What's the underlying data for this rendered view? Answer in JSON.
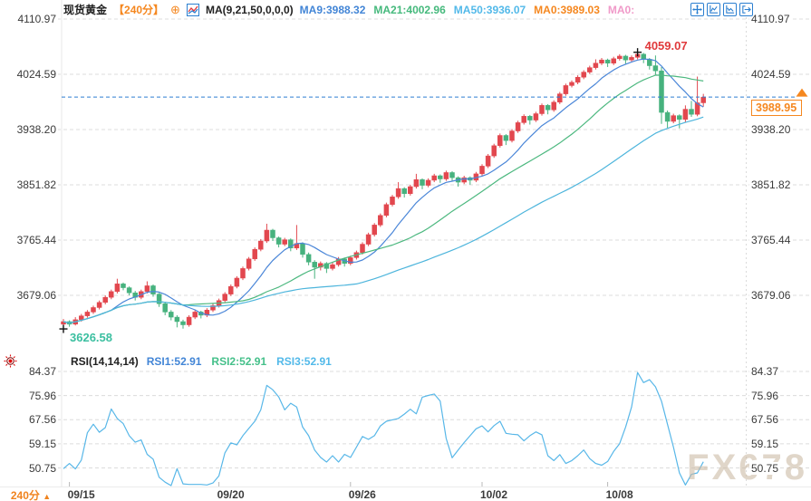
{
  "header": {
    "symbol": "现货黄金",
    "interval": "【240分】",
    "expand_icon": "⊕",
    "ma_settings": "MA(9,21,50,0,0,0)",
    "ma_values": [
      {
        "label": "MA9:3988.32",
        "color": "#4285d6"
      },
      {
        "label": "MA21:4002.96",
        "color": "#45b97c"
      },
      {
        "label": "MA50:3936.07",
        "color": "#52b9e9"
      },
      {
        "label": "MA0:3989.03",
        "color": "#f5871f"
      },
      {
        "label": "MA0:",
        "color": "#f09ac9"
      }
    ]
  },
  "toolbar_icons": [
    "move-icon",
    "chart-zoom-in-icon",
    "chart-zoom-out-icon",
    "exit-fullscreen-icon"
  ],
  "price_marker": {
    "last_price": "3988.95",
    "high_label": "4059.07",
    "low_label": "3626.58"
  },
  "rsi_header": {
    "title": "RSI(14,14,14)",
    "values": [
      {
        "label": "RSI1:52.91",
        "color": "#4285d6"
      },
      {
        "label": "RSI2:52.91",
        "color": "#45c08a"
      },
      {
        "label": "RSI3:52.91",
        "color": "#52b9e9"
      }
    ]
  },
  "bottom_tab": "240分",
  "watermark": "FX678",
  "colors": {
    "up": "#e2474e",
    "down": "#47b27e",
    "ma9": "#4a86d8",
    "ma21": "#4cb87f",
    "ma50": "#4db5dc",
    "rsi_line": "#58b7e8",
    "price_line": "#2d7dd2",
    "accent": "#f5871f",
    "grid": "#dcdcdc"
  },
  "chart_data": {
    "type": "candlestick",
    "title": "现货黄金 240分 (spot gold 4-hour)",
    "y_axis": [
      4110.97,
      4024.59,
      3938.2,
      3851.82,
      3765.44,
      3679.06
    ],
    "rsi_axis": [
      84.37,
      75.96,
      67.56,
      59.15,
      50.75
    ],
    "date_ticks": [
      {
        "label": "09/15",
        "i": 1
      },
      {
        "label": "09/20",
        "i": 26
      },
      {
        "label": "09/26",
        "i": 48
      },
      {
        "label": "10/02",
        "i": 70
      },
      {
        "label": "10/08",
        "i": 91
      }
    ],
    "high_marker": {
      "index": 96,
      "value": 4059.07
    },
    "low_marker": {
      "index": 0,
      "value": 3626.58
    },
    "last_price": 3988.95,
    "ma_lines": [
      {
        "period": 9,
        "color": "#4a86d8"
      },
      {
        "period": 21,
        "color": "#4cb87f"
      },
      {
        "period": 50,
        "color": "#4db5dc"
      }
    ],
    "candles": [
      [
        3634,
        3642,
        3626.58,
        3638
      ],
      [
        3638,
        3640,
        3630,
        3634
      ],
      [
        3634,
        3645,
        3632,
        3641
      ],
      [
        3641,
        3650,
        3638,
        3647
      ],
      [
        3647,
        3656,
        3644,
        3653
      ],
      [
        3653,
        3663,
        3650,
        3660
      ],
      [
        3660,
        3671,
        3657,
        3668
      ],
      [
        3668,
        3679,
        3665,
        3676
      ],
      [
        3676,
        3688,
        3673,
        3685
      ],
      [
        3685,
        3705,
        3682,
        3697
      ],
      [
        3697,
        3699,
        3687,
        3691
      ],
      [
        3691,
        3693,
        3679,
        3683
      ],
      [
        3683,
        3686,
        3671,
        3676
      ],
      [
        3676,
        3688,
        3673,
        3685
      ],
      [
        3685,
        3701,
        3682,
        3694
      ],
      [
        3694,
        3696,
        3677,
        3681
      ],
      [
        3681,
        3683,
        3661,
        3666
      ],
      [
        3666,
        3669,
        3648,
        3653
      ],
      [
        3653,
        3656,
        3640,
        3645
      ],
      [
        3645,
        3648,
        3629,
        3638
      ],
      [
        3638,
        3641,
        3627,
        3633
      ],
      [
        3633,
        3648,
        3630,
        3645
      ],
      [
        3645,
        3656,
        3642,
        3653
      ],
      [
        3653,
        3655,
        3643,
        3648
      ],
      [
        3648,
        3659,
        3645,
        3656
      ],
      [
        3656,
        3666,
        3653,
        3663
      ],
      [
        3663,
        3674,
        3660,
        3671
      ],
      [
        3671,
        3684,
        3668,
        3681
      ],
      [
        3681,
        3696,
        3678,
        3693
      ],
      [
        3693,
        3709,
        3690,
        3706
      ],
      [
        3706,
        3724,
        3703,
        3721
      ],
      [
        3721,
        3739,
        3718,
        3736
      ],
      [
        3736,
        3754,
        3733,
        3751
      ],
      [
        3751,
        3767,
        3748,
        3764
      ],
      [
        3764,
        3791,
        3761,
        3781
      ],
      [
        3781,
        3783,
        3764,
        3769
      ],
      [
        3769,
        3771,
        3754,
        3759
      ],
      [
        3759,
        3769,
        3756,
        3766
      ],
      [
        3766,
        3768,
        3748,
        3753
      ],
      [
        3753,
        3789,
        3750,
        3760
      ],
      [
        3760,
        3762,
        3738,
        3743
      ],
      [
        3743,
        3746,
        3726,
        3731
      ],
      [
        3731,
        3734,
        3705,
        3723
      ],
      [
        3723,
        3732,
        3718,
        3729
      ],
      [
        3729,
        3731,
        3714,
        3721
      ],
      [
        3721,
        3730,
        3718,
        3727
      ],
      [
        3727,
        3739,
        3724,
        3736
      ],
      [
        3736,
        3738,
        3724,
        3729
      ],
      [
        3729,
        3741,
        3726,
        3738
      ],
      [
        3738,
        3749,
        3735,
        3746
      ],
      [
        3746,
        3762,
        3743,
        3759
      ],
      [
        3759,
        3777,
        3756,
        3774
      ],
      [
        3774,
        3792,
        3771,
        3789
      ],
      [
        3789,
        3807,
        3786,
        3804
      ],
      [
        3804,
        3824,
        3801,
        3821
      ],
      [
        3821,
        3836,
        3818,
        3833
      ],
      [
        3833,
        3856,
        3830,
        3846
      ],
      [
        3846,
        3848,
        3832,
        3838
      ],
      [
        3838,
        3852,
        3835,
        3849
      ],
      [
        3849,
        3869,
        3846,
        3860
      ],
      [
        3860,
        3862,
        3845,
        3851
      ],
      [
        3851,
        3862,
        3848,
        3859
      ],
      [
        3859,
        3869,
        3856,
        3866
      ],
      [
        3866,
        3868,
        3855,
        3861
      ],
      [
        3861,
        3874,
        3858,
        3871
      ],
      [
        3871,
        3873,
        3857,
        3863
      ],
      [
        3863,
        3865,
        3849,
        3856
      ],
      [
        3856,
        3866,
        3853,
        3863
      ],
      [
        3863,
        3865,
        3852,
        3859
      ],
      [
        3859,
        3872,
        3856,
        3869
      ],
      [
        3869,
        3884,
        3866,
        3881
      ],
      [
        3881,
        3900,
        3878,
        3897
      ],
      [
        3897,
        3916,
        3894,
        3913
      ],
      [
        3913,
        3932,
        3910,
        3929
      ],
      [
        3929,
        3931,
        3914,
        3921
      ],
      [
        3921,
        3939,
        3918,
        3936
      ],
      [
        3936,
        3952,
        3933,
        3949
      ],
      [
        3949,
        3962,
        3946,
        3959
      ],
      [
        3959,
        3961,
        3946,
        3953
      ],
      [
        3953,
        3966,
        3950,
        3963
      ],
      [
        3963,
        3979,
        3960,
        3976
      ],
      [
        3976,
        3978,
        3962,
        3969
      ],
      [
        3969,
        3984,
        3966,
        3981
      ],
      [
        3981,
        3997,
        3978,
        3994
      ],
      [
        3994,
        4010,
        3991,
        4007
      ],
      [
        4007,
        4015,
        4004,
        4012
      ],
      [
        4012,
        4023,
        4009,
        4020
      ],
      [
        4020,
        4031,
        4017,
        4028
      ],
      [
        4028,
        4038,
        4025,
        4035
      ],
      [
        4035,
        4048,
        4032,
        4042
      ],
      [
        4042,
        4050,
        4039,
        4047
      ],
      [
        4047,
        4049,
        4036,
        4042
      ],
      [
        4042,
        4052,
        4039,
        4049
      ],
      [
        4049,
        4056,
        4046,
        4053
      ],
      [
        4053,
        4055,
        4041,
        4047
      ],
      [
        4047,
        4054,
        4044,
        4051
      ],
      [
        4051,
        4059.07,
        4048,
        4056
      ],
      [
        4056,
        4058,
        4042,
        4048
      ],
      [
        4048,
        4050,
        4032,
        4038
      ],
      [
        4038,
        4054,
        4024,
        4030
      ],
      [
        4030,
        4036,
        3947,
        3965
      ],
      [
        3965,
        3968,
        3941,
        3951
      ],
      [
        3951,
        3963,
        3948,
        3960
      ],
      [
        3960,
        3962,
        3940,
        3954
      ],
      [
        3954,
        3976,
        3949,
        3970
      ],
      [
        3970,
        3983,
        3958,
        3962
      ],
      [
        3962,
        4021,
        3959,
        3980
      ],
      [
        3980,
        3994,
        3974,
        3988.95
      ]
    ],
    "rsi": [
      50.5,
      52.3,
      50.4,
      53.5,
      63,
      66,
      63.2,
      64.8,
      71.3,
      68,
      66.2,
      62,
      59.7,
      60.5,
      55.5,
      53.8,
      47.5,
      45.8,
      44.5,
      50.5,
      45.2,
      45,
      45,
      45,
      44.8,
      45.5,
      48,
      56,
      59.5,
      58.8,
      62,
      64.5,
      67,
      71,
      79.5,
      78,
      75.5,
      71,
      73.3,
      72,
      65,
      62,
      57,
      54.4,
      52.8,
      55,
      52.8,
      55.5,
      54.4,
      58,
      61.7,
      60.7,
      62,
      65.4,
      67,
      67.5,
      68,
      69.5,
      71.2,
      69.6,
      75.4,
      76,
      76.5,
      74,
      61,
      54.3,
      57,
      59.6,
      62,
      64.4,
      65.4,
      63.3,
      65.5,
      67,
      62.8,
      62.5,
      62.3,
      60.2,
      62,
      63.3,
      62.3,
      55,
      53.3,
      55.4,
      52.3,
      53.3,
      55,
      57,
      54,
      52.3,
      51.7,
      53,
      56.5,
      59.2,
      65,
      72,
      84,
      80.5,
      81.5,
      79,
      74,
      66,
      58,
      49,
      44.8,
      48.5,
      49,
      52.91
    ]
  }
}
